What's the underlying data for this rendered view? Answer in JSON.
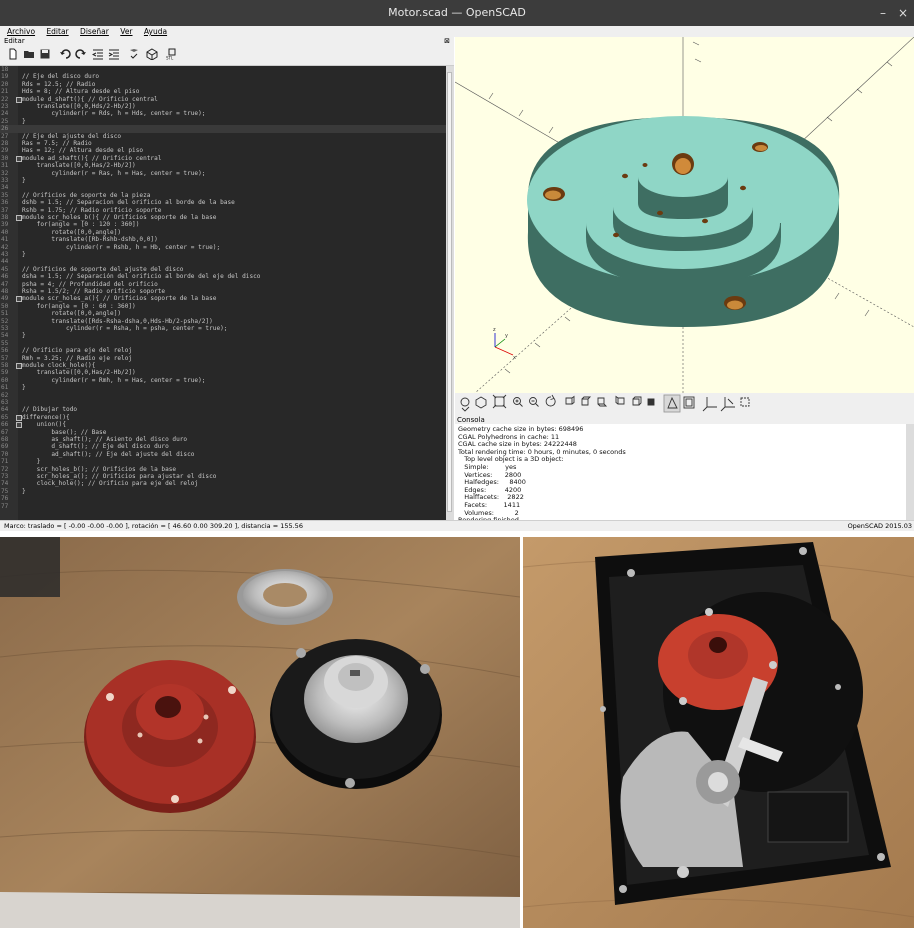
{
  "window": {
    "title": "Motor.scad — OpenSCAD",
    "min_glyph": "–",
    "close_glyph": "×"
  },
  "menu": [
    "Archivo",
    "Editar",
    "Diseñar",
    "Ver",
    "Ayuda"
  ],
  "editor": {
    "header": "Editar",
    "close_glyph": "⊠",
    "lines": [
      {
        "n": "18",
        "t": ""
      },
      {
        "n": "19",
        "t": "// Eje del disco duro"
      },
      {
        "n": "20",
        "t": "Rds = 12.5; // Radio"
      },
      {
        "n": "21",
        "t": "Hds = 8; // Altura desde el piso"
      },
      {
        "n": "22",
        "t": "module d_shaft(){ // Orificio central",
        "f": true
      },
      {
        "n": "23",
        "t": "    translate([0,0,Hds/2-Hb/2])"
      },
      {
        "n": "24",
        "t": "        cylinder(r = Rds, h = Hds, center = true);"
      },
      {
        "n": "25",
        "t": "}"
      },
      {
        "n": "26",
        "t": "",
        "hl": true
      },
      {
        "n": "27",
        "t": "// Eje del ajuste del disco"
      },
      {
        "n": "28",
        "t": "Ras = 7.5; // Radio"
      },
      {
        "n": "29",
        "t": "Has = 12; // Altura desde el piso"
      },
      {
        "n": "30",
        "t": "module ad_shaft(){ // Orificio central",
        "f": true
      },
      {
        "n": "31",
        "t": "    translate([0,0,Has/2-Hb/2])"
      },
      {
        "n": "32",
        "t": "        cylinder(r = Ras, h = Has, center = true);"
      },
      {
        "n": "33",
        "t": "}"
      },
      {
        "n": "34",
        "t": ""
      },
      {
        "n": "35",
        "t": "// Orificios de soporte de la pieza"
      },
      {
        "n": "36",
        "t": "dshb = 1.5; // Separacion del orificio al borde de la base"
      },
      {
        "n": "37",
        "t": "Rshb = 1.75; // Radio orificio soporte"
      },
      {
        "n": "38",
        "t": "module scr_holes_b(){ // Orificios soporte de la base",
        "f": true
      },
      {
        "n": "39",
        "t": "    for(angle = [0 : 120 : 360])"
      },
      {
        "n": "40",
        "t": "        rotate([0,0,angle])"
      },
      {
        "n": "41",
        "t": "        translate([Rb-Rshb-dshb,0,0])"
      },
      {
        "n": "42",
        "t": "            cylinder(r = Rshb, h = Hb, center = true);"
      },
      {
        "n": "43",
        "t": "}"
      },
      {
        "n": "44",
        "t": ""
      },
      {
        "n": "45",
        "t": "// Orificios de soporte del ajuste del disco"
      },
      {
        "n": "46",
        "t": "dsha = 1.5; // Separación del orificio al borde del eje del disco"
      },
      {
        "n": "47",
        "t": "psha = 4; // Profundidad del orificio"
      },
      {
        "n": "48",
        "t": "Rsha = 1.5/2; // Radio orificio soporte"
      },
      {
        "n": "49",
        "t": "module scr_holes_a(){ // Orificios soporte de la base",
        "f": true
      },
      {
        "n": "50",
        "t": "    for(angle = [0 : 60 : 360])"
      },
      {
        "n": "51",
        "t": "        rotate([0,0,angle])"
      },
      {
        "n": "52",
        "t": "        translate([Rds-Rsha-dsha,0,Hds-Hb/2-psha/2])"
      },
      {
        "n": "53",
        "t": "            cylinder(r = Rsha, h = psha, center = true);"
      },
      {
        "n": "54",
        "t": "}"
      },
      {
        "n": "55",
        "t": ""
      },
      {
        "n": "56",
        "t": "// Orificio para eje del reloj"
      },
      {
        "n": "57",
        "t": "Rmh = 3.25; // Radio eje reloj"
      },
      {
        "n": "58",
        "t": "module clock_hole(){",
        "f": true
      },
      {
        "n": "59",
        "t": "    translate([0,0,Has/2-Hb/2])"
      },
      {
        "n": "60",
        "t": "        cylinder(r = Rmh, h = Has, center = true);"
      },
      {
        "n": "61",
        "t": "}"
      },
      {
        "n": "62",
        "t": ""
      },
      {
        "n": "63",
        "t": ""
      },
      {
        "n": "64",
        "t": "// Dibujar todo"
      },
      {
        "n": "65",
        "t": "difference(){",
        "f": true
      },
      {
        "n": "66",
        "t": "    union(){",
        "f": true
      },
      {
        "n": "67",
        "t": "        base(); // Base"
      },
      {
        "n": "68",
        "t": "        as_shaft(); // Asiento del disco duro"
      },
      {
        "n": "69",
        "t": "        d_shaft(); // Eje del disco duro"
      },
      {
        "n": "70",
        "t": "        ad_shaft(); // Eje del ajuste del disco"
      },
      {
        "n": "71",
        "t": "    }"
      },
      {
        "n": "72",
        "t": "    scr_holes_b(); // Orificios de la base"
      },
      {
        "n": "73",
        "t": "    scr_holes_a(); // Orificios para ajustar el disco"
      },
      {
        "n": "74",
        "t": "    clock_hole(); // Orificio para eje del reloj"
      },
      {
        "n": "75",
        "t": "}"
      },
      {
        "n": "76",
        "t": ""
      },
      {
        "n": "77",
        "t": ""
      }
    ]
  },
  "console": {
    "header": "Consola",
    "lines": [
      "Geometry cache size in bytes: 698496",
      "CGAL Polyhedrons in cache: 11",
      "CGAL cache size in bytes: 24222448",
      "Total rendering time: 0 hours, 0 minutes, 0 seconds",
      "   Top level object is a 3D object:",
      "   Simple:        yes",
      "   Vertices:      2800",
      "   Halfedges:     8400",
      "   Edges:         4200",
      "   Halffacets:    2822",
      "   Facets:        1411",
      "   Volumes:          2",
      "Rendering finished."
    ]
  },
  "status": {
    "left": "Marco: traslado = [ -0.00 -0.00 -0.00 ], rotación = [ 46.60 0.00 309.20 ], distancia = 155.56",
    "right": "OpenSCAD 2015.03"
  },
  "viewport_axes": [
    "x",
    "y",
    "z"
  ],
  "colors": {
    "model": "#8fd6c6",
    "background": "#ffffe5",
    "editor_bg": "#282828",
    "print_red": "#a83026"
  }
}
